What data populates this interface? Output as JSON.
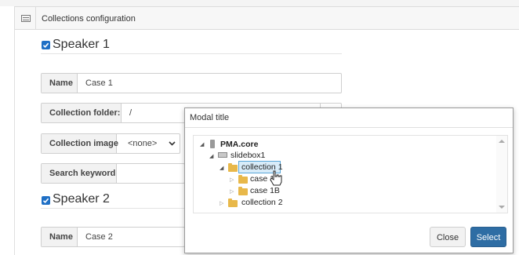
{
  "panel": {
    "title": "Collections configuration",
    "icon": "list-icon"
  },
  "speaker1": {
    "title": "Speaker 1",
    "checked": true,
    "name_label": "Name",
    "name_value": "Case 1",
    "folder_label": "Collection folder:",
    "folder_value": "/",
    "image_label": "Collection image",
    "image_value": "<none>",
    "keyword_label": "Search keyword",
    "keyword_value": ""
  },
  "speaker2": {
    "title": "Speaker 2",
    "checked": true,
    "name_label": "Name",
    "name_value": "Case 2"
  },
  "modal": {
    "title": "Modal title",
    "tree": {
      "root": "PMA.core",
      "slidebox": "slidebox1",
      "collection1": "collection 1",
      "case1": "case 1",
      "case1b": "case 1B",
      "collection2": "collection 2"
    },
    "close_label": "Close",
    "select_label": "Select"
  },
  "colors": {
    "accent": "#2e6da4",
    "checkbox": "#1f6fc5",
    "folder": "#e8b84a",
    "selected_bg": "#d8ecf9"
  }
}
